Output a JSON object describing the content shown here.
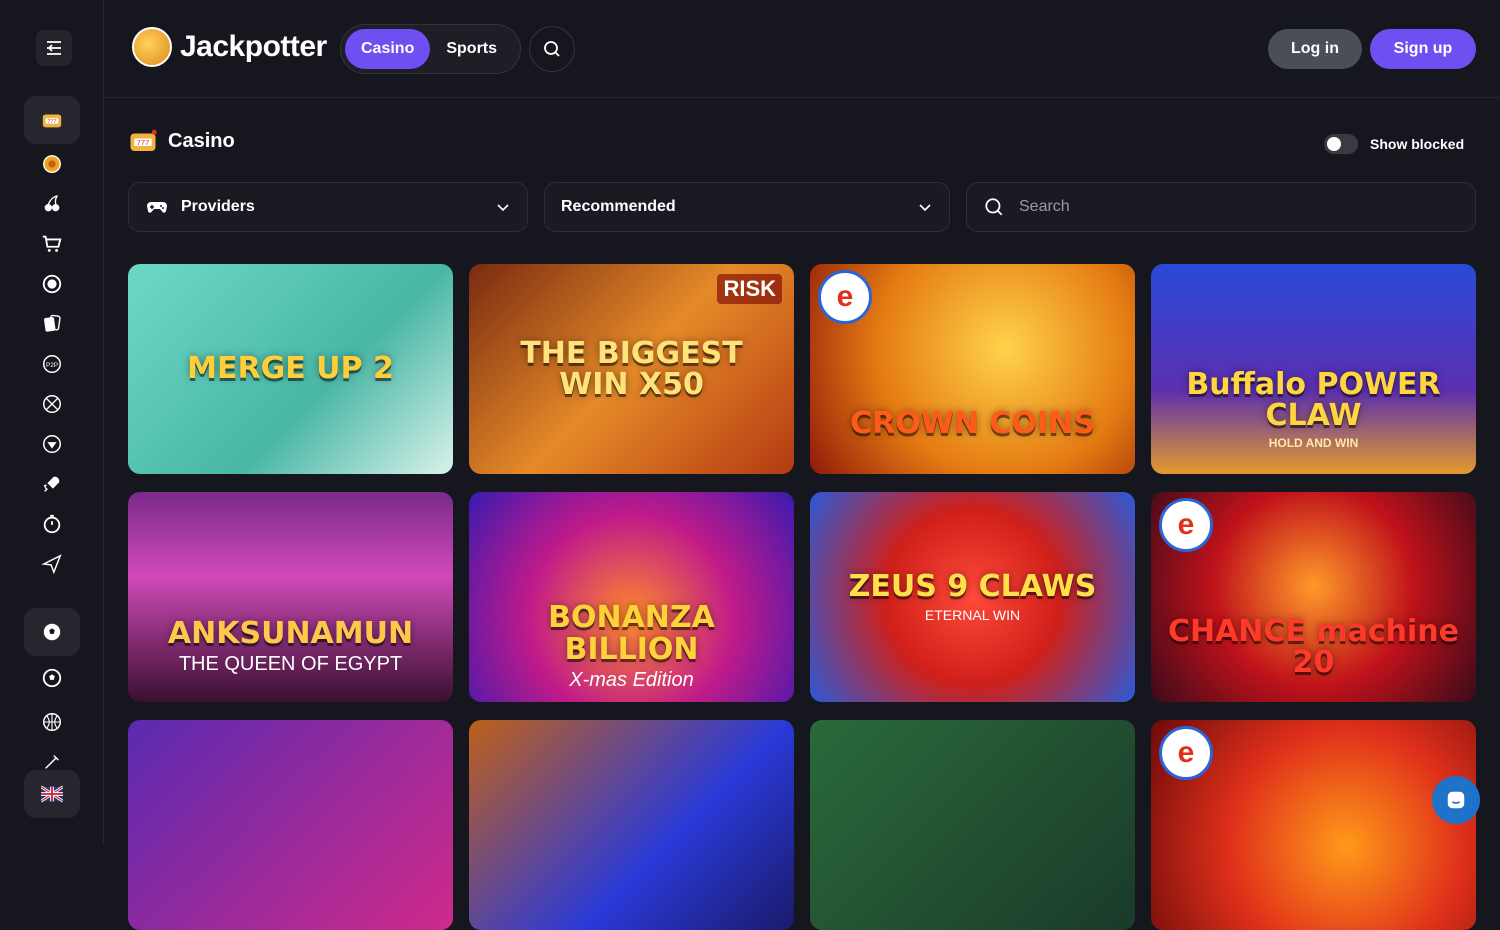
{
  "header": {
    "brand": "Jackpotter",
    "tabs": [
      {
        "label": "Casino"
      },
      {
        "label": "Sports"
      }
    ],
    "login_label": "Log in",
    "signup_label": "Sign up"
  },
  "section": {
    "title": "Casino",
    "show_blocked_label": "Show blocked",
    "show_blocked_on": false
  },
  "filters": {
    "providers_label": "Providers",
    "sort_label": "Recommended",
    "search_placeholder": "Search"
  },
  "games": [
    {
      "title": "MERGE UP 2",
      "badge": ""
    },
    {
      "title": "THE BIGGEST WIN X50",
      "badge": "RISK"
    },
    {
      "title": "CROWN COINS",
      "badge": "e"
    },
    {
      "title": "Buffalo POWER CLAW",
      "subtitle": "HOLD AND WIN",
      "badge": ""
    },
    {
      "title": "ANKSUNAMUN",
      "subtitle": "THE QUEEN OF EGYPT",
      "badge": ""
    },
    {
      "title": "BONANZA BILLION",
      "subtitle": "X-mas Edition",
      "badge": ""
    },
    {
      "title": "ZEUS 9 CLAWS",
      "subtitle": "ETERNAL WIN",
      "badge": ""
    },
    {
      "title": "CHANCE machine 20",
      "badge": "e"
    },
    {
      "title": "",
      "badge": ""
    },
    {
      "title": "",
      "badge": ""
    },
    {
      "title": "",
      "badge": ""
    },
    {
      "title": "",
      "badge": "e"
    }
  ],
  "colors": {
    "accent": "#6f4ef2",
    "background": "#16161f",
    "login_button": "#4b4d57"
  },
  "sidebar_icons": [
    "menu-collapse-icon",
    "slot-machine-icon",
    "jackpot-icon",
    "cherries-icon",
    "shopping-cart-icon",
    "live-casino-icon",
    "cards-icon",
    "p2p-icon",
    "roulette-icon",
    "gem-icon",
    "rocket-icon",
    "stopwatch-icon",
    "paper-plane-icon",
    "soccer-ball-icon",
    "football-icon",
    "basketball-icon",
    "tennis-icon",
    "uk-flag-icon"
  ]
}
